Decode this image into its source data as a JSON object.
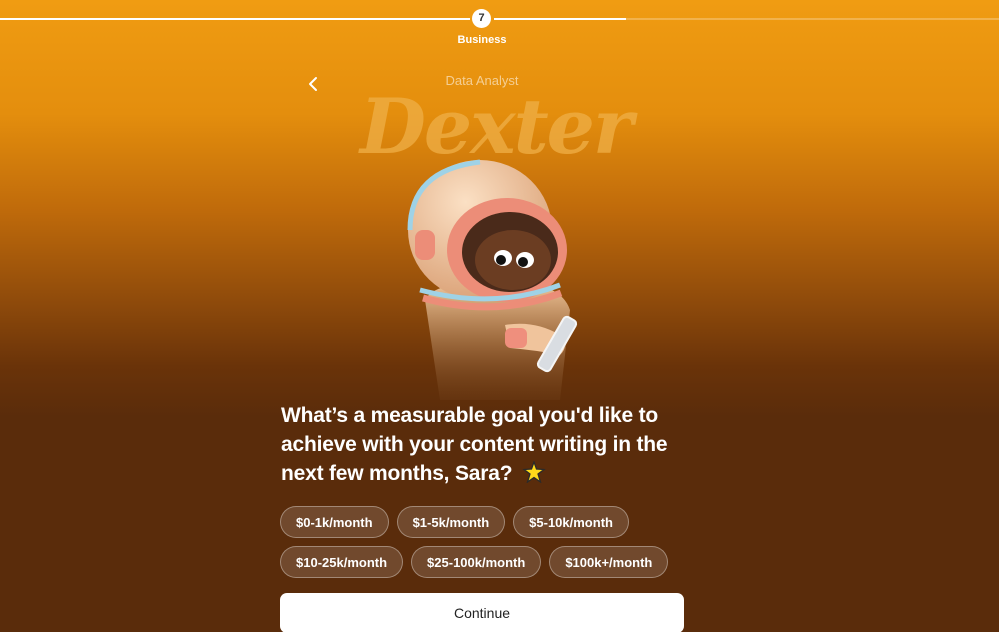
{
  "progress": {
    "step_number": "7",
    "step_label": "Business"
  },
  "header": {
    "role": "Data Analyst",
    "name": "Dexter"
  },
  "question": {
    "text": "What’s a measurable goal you'd like to achieve with your content writing in the next few months, Sara?",
    "emoji_icon": "sparkle-star-icon"
  },
  "options": [
    [
      "$0-1k/month",
      "$1-5k/month",
      "$5-10k/month"
    ],
    [
      "$10-25k/month",
      "$25-100k/month",
      "$100k+/month"
    ]
  ],
  "continue_label": "Continue",
  "colors": {
    "background_top": "#f09c12",
    "background_bottom": "#5a2c0b",
    "title_accent": "#efae45"
  }
}
